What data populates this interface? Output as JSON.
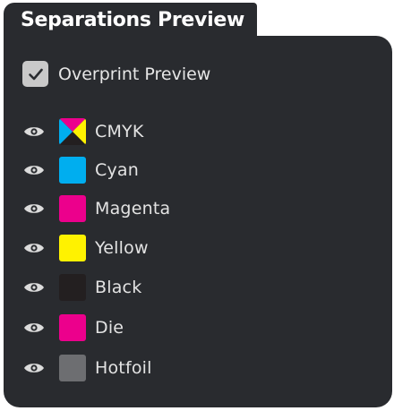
{
  "panel": {
    "title": "Separations Preview",
    "overprint": {
      "label": "Overprint Preview",
      "checked": true,
      "icon": "check-icon"
    },
    "separations": [
      {
        "name": "CMYK",
        "visible": true,
        "swatch": "cmyk",
        "icon": "eye-icon"
      },
      {
        "name": "Cyan",
        "visible": true,
        "color": "#00aeef",
        "icon": "eye-icon"
      },
      {
        "name": "Magenta",
        "visible": true,
        "color": "#ec008c",
        "icon": "eye-icon"
      },
      {
        "name": "Yellow",
        "visible": true,
        "color": "#fff200",
        "icon": "eye-icon"
      },
      {
        "name": "Black",
        "visible": true,
        "color": "#231f20",
        "icon": "eye-icon"
      },
      {
        "name": "Die",
        "visible": true,
        "color": "#ec008c",
        "icon": "eye-icon"
      },
      {
        "name": "Hotfoil",
        "visible": true,
        "color": "#6d6e71",
        "icon": "eye-icon"
      }
    ]
  }
}
